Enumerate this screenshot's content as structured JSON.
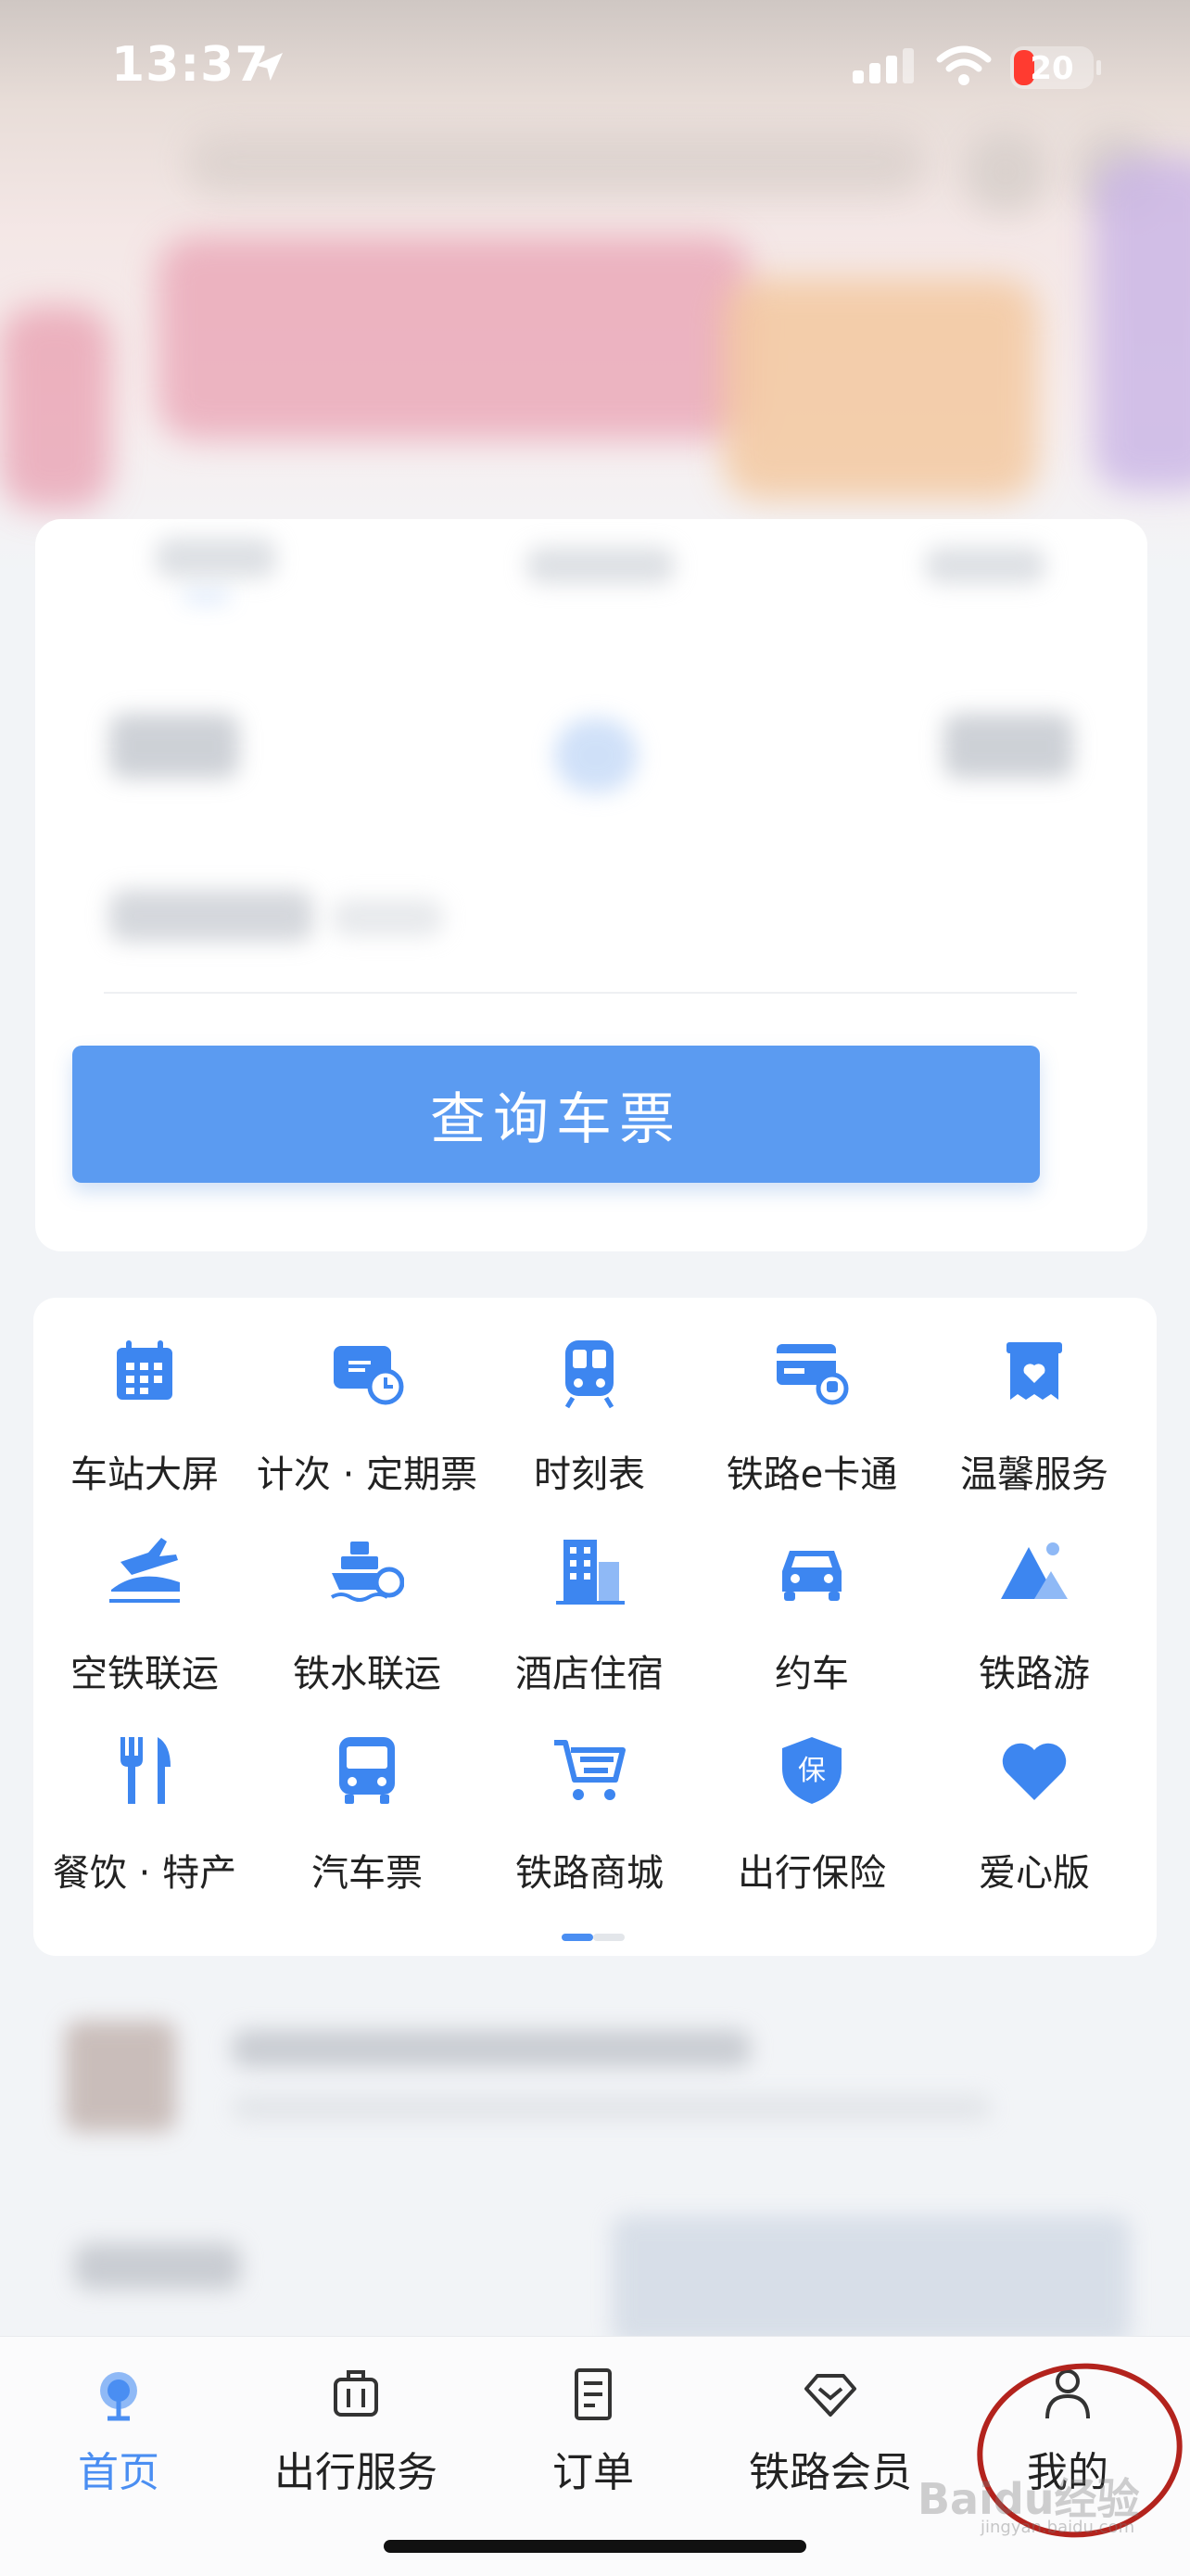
{
  "status_bar": {
    "time": "13:37",
    "battery": "20"
  },
  "search": {
    "button_label": "查询车票"
  },
  "services": [
    {
      "label": "车站大屏",
      "icon": "calendar-grid-icon"
    },
    {
      "label": "计次 · 定期票",
      "icon": "ticket-clock-icon"
    },
    {
      "label": "时刻表",
      "icon": "train-icon"
    },
    {
      "label": "铁路e卡通",
      "icon": "card-train-icon"
    },
    {
      "label": "温馨服务",
      "icon": "heart-box-icon"
    },
    {
      "label": "空铁联运",
      "icon": "plane-train-icon"
    },
    {
      "label": "铁水联运",
      "icon": "ship-train-icon"
    },
    {
      "label": "酒店住宿",
      "icon": "building-icon"
    },
    {
      "label": "约车",
      "icon": "car-icon"
    },
    {
      "label": "铁路游",
      "icon": "mountain-icon"
    },
    {
      "label": "餐饮 · 特产",
      "icon": "fork-knife-icon"
    },
    {
      "label": "汽车票",
      "icon": "bus-icon"
    },
    {
      "label": "铁路商城",
      "icon": "cart-icon"
    },
    {
      "label": "出行保险",
      "icon": "shield-icon"
    },
    {
      "label": "爱心版",
      "icon": "heart-icon"
    }
  ],
  "tabs": [
    {
      "label": "首页",
      "icon": "home-train-icon",
      "active": true
    },
    {
      "label": "出行服务",
      "icon": "luggage-icon",
      "active": false
    },
    {
      "label": "订单",
      "icon": "document-icon",
      "active": false
    },
    {
      "label": "铁路会员",
      "icon": "diamond-icon",
      "active": false
    },
    {
      "label": "我的",
      "icon": "person-icon",
      "active": false
    }
  ],
  "watermark": {
    "text": "Baidu经验",
    "sub": "jingyan.baidu.com"
  },
  "colors": {
    "accent": "#4a8ef2",
    "button": "#5b9bf1",
    "highlight_circle": "#b3231d"
  }
}
